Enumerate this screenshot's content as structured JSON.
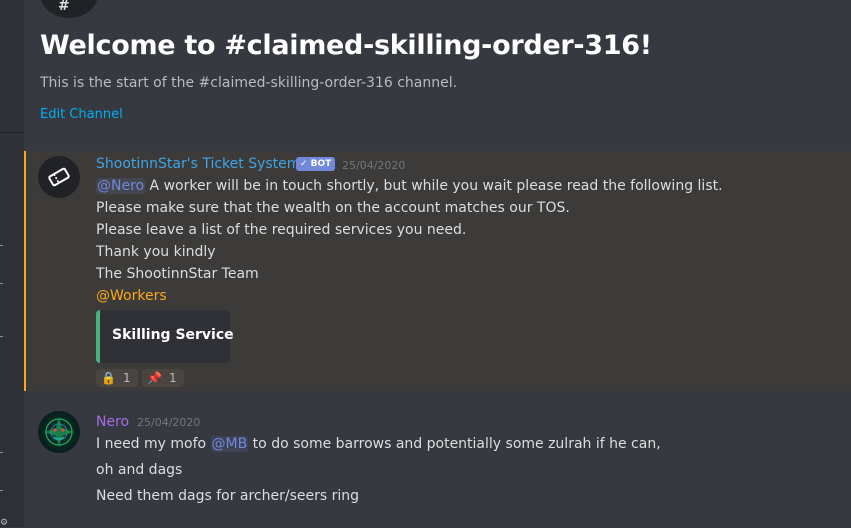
{
  "channel": {
    "welcome_title": "Welcome to #claimed-skilling-order-316!",
    "welcome_subtitle": "This is the start of the #claimed-skilling-order-316 channel.",
    "edit_link": "Edit Channel"
  },
  "messages": {
    "bot": {
      "author": "ShootinnStar's Ticket System",
      "tag": "✓ BOT",
      "timestamp": "25/04/2020",
      "mention_user": "@Nero",
      "line1_rest": " A worker will be in touch shortly, but while you wait please read the following list.",
      "line2": "Please make sure that the wealth on the account matches our TOS.",
      "line3": "Please leave a list of the required services you need.",
      "line4": "Thank you kindly",
      "line5": "The ShootinnStar Team",
      "mention_role": "@Workers",
      "embed_title": "Skilling Service",
      "reactions": [
        {
          "emoji": "🔒",
          "count": "1"
        },
        {
          "emoji": "📌",
          "count": "1"
        }
      ]
    },
    "user": {
      "author": "Nero",
      "timestamp": "25/04/2020",
      "line1_pre": "I need my mofo ",
      "mention": "@MB",
      "line1_post": " to do some barrows and potentially some zulrah if he can,",
      "line2": "oh and dags",
      "line3": "Need them dags for archer/seers ring"
    }
  },
  "colors": {
    "background": "#36393f",
    "highlight_bg": "#3d3b39",
    "highlight_border": "#faa81a",
    "bot_name": "#3ea4e5",
    "user_name": "#a46ce6",
    "embed_border": "#43b581",
    "link": "#00b0f4"
  },
  "icons": {
    "bot_avatar": "ticket-icon",
    "server_header": "server-icon",
    "settings": "gear-icon"
  }
}
